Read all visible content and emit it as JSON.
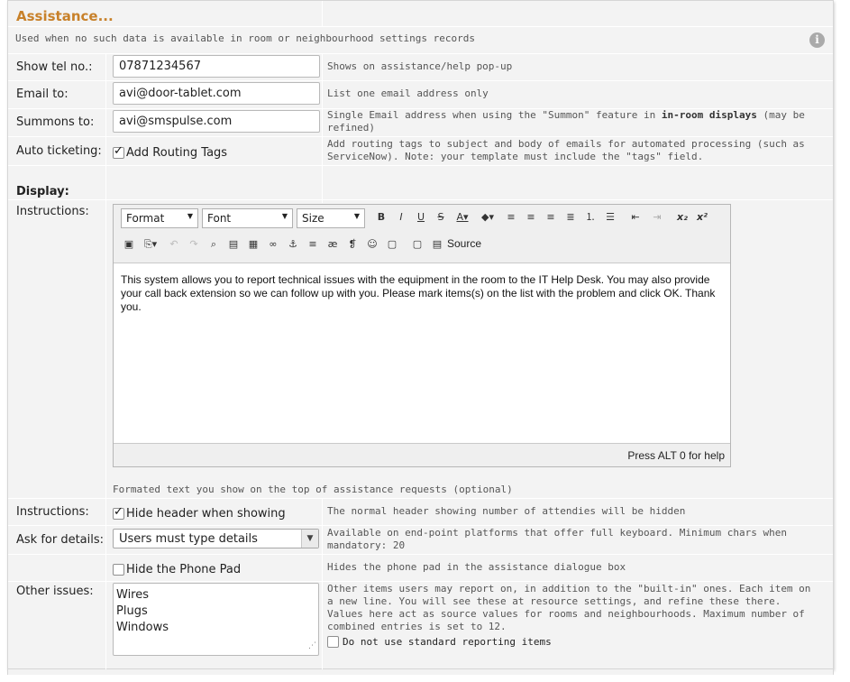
{
  "section": {
    "title": "Assistance...",
    "description": "Used when no such data is available in room or neighbourhood settings records"
  },
  "icons": {
    "info": "info-icon",
    "check": "checkmark-icon",
    "dropdown": "chevron-down-icon"
  },
  "colors": {
    "title": "#c8812a",
    "panel": "#f3f3f3"
  },
  "rows": {
    "tel": {
      "label": "Show tel no.:",
      "value": "07871234567",
      "hint": "Shows on assistance/help pop-up"
    },
    "email": {
      "label": "Email to:",
      "value": "avi@door-tablet.com",
      "hint": "List one email address only"
    },
    "summons": {
      "label": "Summons to:",
      "value": "avi@smspulse.com",
      "hint_before": "Single Email address when using the \"Summon\" feature in ",
      "hint_bold": "in-room displays",
      "hint_after": " (may be refined)"
    },
    "ticketing": {
      "label": "Auto ticketing:",
      "checkbox_label": "Add Routing Tags",
      "checked": true,
      "hint": "Add routing tags to subject and body of emails for automated processing (such as ServiceNow). Note: your template must include the \"tags\" field."
    },
    "display": {
      "label": "Display:"
    },
    "instructions": {
      "label": "Instructions:",
      "editor": {
        "format_label": "Format",
        "font_label": "Font",
        "size_label": "Size",
        "source_label": "Source",
        "content": "This system allows you to report technical issues with the equipment in the room to the IT Help Desk. You may also provide your call back extension so we can follow up with you. Please mark items(s) on the list with the problem and click OK. Thank you.",
        "status": "Press ALT 0 for help"
      },
      "hint": "Formated text you show on the top of assistance requests (optional)"
    },
    "instructions2": {
      "label": "Instructions:",
      "checkbox_label": "Hide header when showing",
      "checked": true,
      "hint": "The normal header showing number of attendies will be hidden"
    },
    "details": {
      "label": "Ask for details:",
      "selected": "Users must type details",
      "hint": "Available on end-point platforms that offer full keyboard. Minimum chars when mandatory: 20"
    },
    "phonepad": {
      "checkbox_label": "Hide the Phone Pad",
      "checked": false,
      "hint": "Hides the phone pad in the assistance dialogue box"
    },
    "other": {
      "label": "Other issues:",
      "items": [
        "Wires",
        "Plugs",
        "Windows"
      ],
      "hint": "Other items users may report on, in addition to the \"built-in\" ones. Each item on a new line. You will see these at resource settings, and refine these there. Values here act as source values for rooms and neighbourhoods. Maximum number of combined entries is set to 12.",
      "checkbox_label": "Do not use standard reporting items",
      "checked": false
    }
  }
}
